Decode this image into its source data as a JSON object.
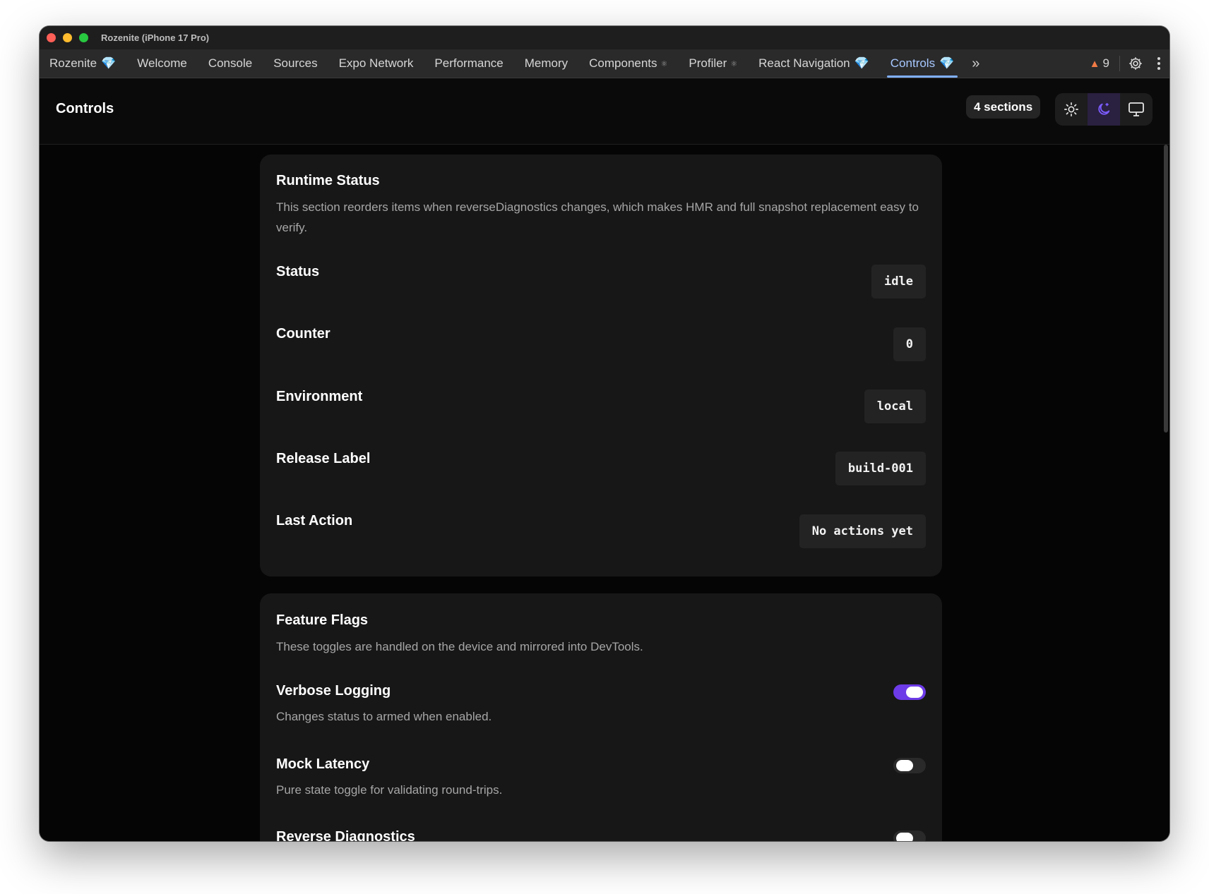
{
  "window": {
    "title": "Rozenite (iPhone 17 Pro)",
    "traffic_colors": [
      "#fe5f57",
      "#febc2e",
      "#28c840"
    ]
  },
  "tabs": [
    {
      "label": "Rozenite",
      "suffix": "gem-icon"
    },
    {
      "label": "Welcome"
    },
    {
      "label": "Console"
    },
    {
      "label": "Sources"
    },
    {
      "label": "Expo Network"
    },
    {
      "label": "Performance"
    },
    {
      "label": "Memory"
    },
    {
      "label": "Components",
      "suffix": "react-icon"
    },
    {
      "label": "Profiler",
      "suffix": "react-icon"
    },
    {
      "label": "React Navigation",
      "suffix": "gem-icon"
    },
    {
      "label": "Controls",
      "suffix": "gem-icon",
      "active": true
    }
  ],
  "toolbar": {
    "warning_count": "9",
    "warning_icon": "warning-triangle-icon",
    "settings_icon": "gear-icon",
    "more_icon": "vertical-dots-icon",
    "overflow_icon": "double-chevron-right-icon"
  },
  "header": {
    "title": "Controls",
    "sections_badge": "4 sections",
    "theme_options": [
      "light",
      "dark",
      "system"
    ],
    "active_theme": "dark",
    "accent": "#7c5cff"
  },
  "runtime_status": {
    "title": "Runtime Status",
    "description": "This section reorders items when reverseDiagnostics changes, which makes HMR and full snapshot replacement easy to verify.",
    "rows": [
      {
        "label": "Status",
        "value": "idle"
      },
      {
        "label": "Counter",
        "value": "0"
      },
      {
        "label": "Environment",
        "value": "local"
      },
      {
        "label": "Release Label",
        "value": "build-001"
      },
      {
        "label": "Last Action",
        "value": "No actions yet"
      }
    ]
  },
  "feature_flags": {
    "title": "Feature Flags",
    "description": "These toggles are handled on the device and mirrored into DevTools.",
    "toggles": [
      {
        "label": "Verbose Logging",
        "description": "Changes status to armed when enabled.",
        "enabled": true
      },
      {
        "label": "Mock Latency",
        "description": "Pure state toggle for validating round-trips.",
        "enabled": false
      },
      {
        "label": "Reverse Diagnostics",
        "description": "",
        "enabled": false
      }
    ]
  }
}
